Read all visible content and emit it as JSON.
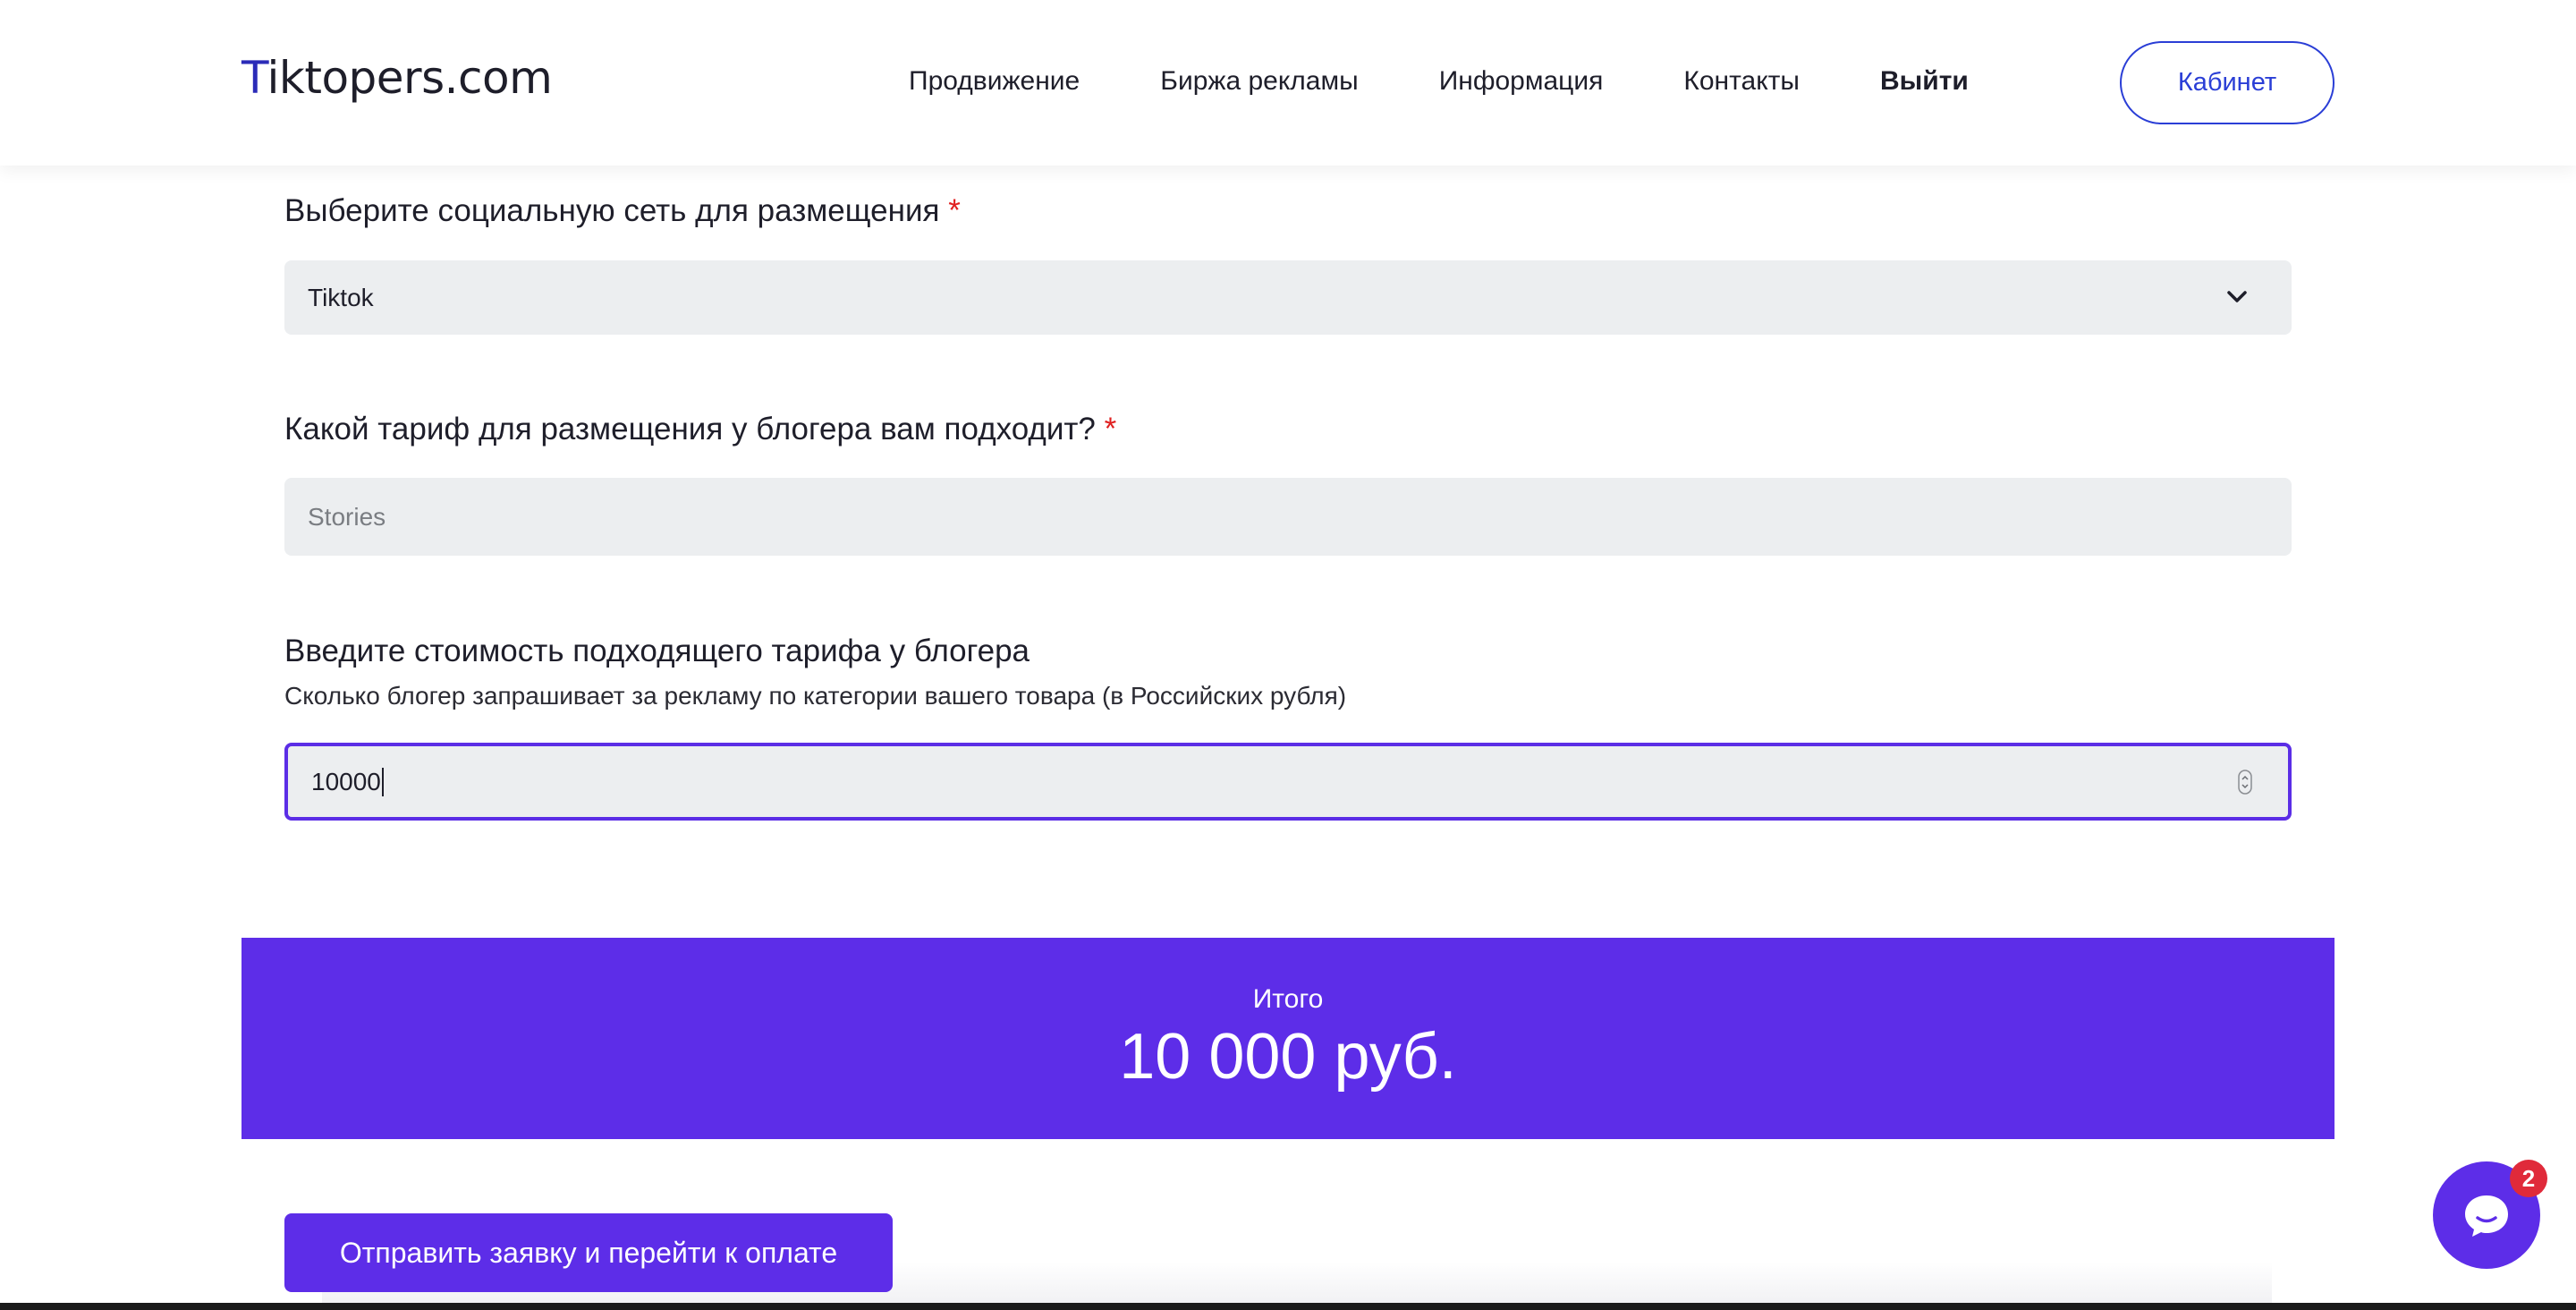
{
  "header": {
    "logo_prefix": "T",
    "logo_rest": "iktopers.com",
    "nav": [
      {
        "label": "Продвижение"
      },
      {
        "label": "Биржа рекламы"
      },
      {
        "label": "Информация"
      },
      {
        "label": "Контакты"
      },
      {
        "label": "Выйти"
      }
    ],
    "cabinet_label": "Кабинет"
  },
  "form": {
    "network_label": "Выберите социальную сеть для размещения",
    "network_required": "*",
    "network_value": "Tiktok",
    "tariff_label": "Какой тариф для размещения у блогера вам подходит?",
    "tariff_required": "*",
    "tariff_placeholder": "Stories",
    "price_label": "Введите стоимость подходящего тарифа у блогера",
    "price_hint": "Сколько блогер запрашивает за рекламу по категории вашего товара (в Российских рубля)",
    "price_value": "10000"
  },
  "total": {
    "label": "Итого",
    "value": "10 000 руб."
  },
  "submit_label": "Отправить заявку и перейти к оплате",
  "chat": {
    "badge_count": "2"
  },
  "colors": {
    "accent": "#5d2de8",
    "link_blue": "#2a3ed6",
    "required_red": "#e02020",
    "field_bg": "#eceef0"
  },
  "icons": {
    "select": "chevron-down-icon",
    "spinner": "number-spinner-icon",
    "chat": "chat-bubble-icon"
  }
}
